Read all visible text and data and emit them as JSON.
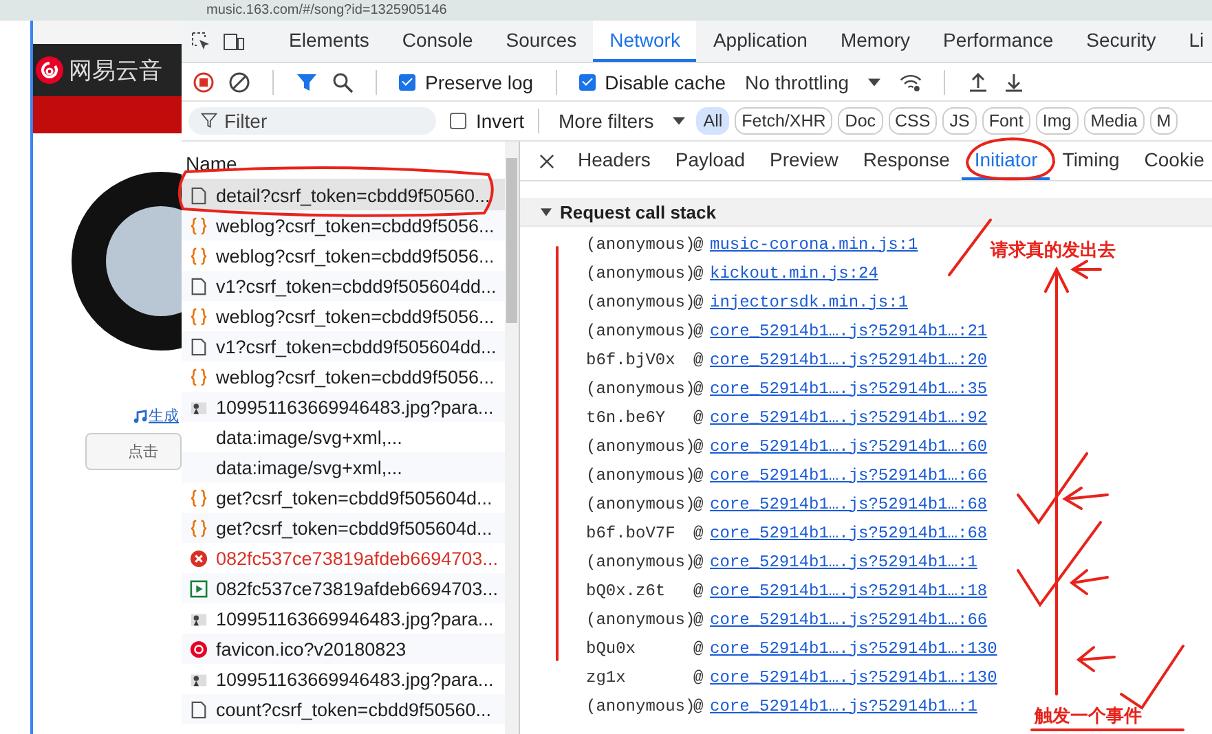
{
  "browser": {
    "address": "music.163.com/#/song?id=1325905146"
  },
  "page": {
    "logo": "网易云音",
    "link": "生成",
    "button": "点击"
  },
  "devtools": {
    "tabs": [
      {
        "label": "Elements",
        "selected": false
      },
      {
        "label": "Console",
        "selected": false
      },
      {
        "label": "Sources",
        "selected": false
      },
      {
        "label": "Network",
        "selected": true
      },
      {
        "label": "Application",
        "selected": false
      },
      {
        "label": "Memory",
        "selected": false
      },
      {
        "label": "Performance",
        "selected": false
      },
      {
        "label": "Security",
        "selected": false
      },
      {
        "label": "Li",
        "selected": false
      }
    ],
    "toolbar": {
      "preserve_log": {
        "label": "Preserve log",
        "checked": true
      },
      "disable_cache": {
        "label": "Disable cache",
        "checked": true
      },
      "throttling": "No throttling"
    },
    "filter": {
      "placeholder": "Filter",
      "invert": {
        "label": "Invert",
        "checked": false
      },
      "more_filters": "More filters",
      "types": [
        {
          "label": "All",
          "selected": true
        },
        {
          "label": "Fetch/XHR",
          "selected": false
        },
        {
          "label": "Doc",
          "selected": false
        },
        {
          "label": "CSS",
          "selected": false
        },
        {
          "label": "JS",
          "selected": false
        },
        {
          "label": "Font",
          "selected": false
        },
        {
          "label": "Img",
          "selected": false
        },
        {
          "label": "Media",
          "selected": false
        },
        {
          "label": "M",
          "selected": false
        }
      ]
    },
    "requests": {
      "column": "Name",
      "rows": [
        {
          "kind": "doc",
          "name": "detail?csrf_token=cbdd9f50560...",
          "selected": true
        },
        {
          "kind": "xhr",
          "name": "weblog?csrf_token=cbdd9f5056...",
          "selected": false
        },
        {
          "kind": "xhr",
          "name": "weblog?csrf_token=cbdd9f5056...",
          "selected": false
        },
        {
          "kind": "doc",
          "name": "v1?csrf_token=cbdd9f505604dd...",
          "selected": false
        },
        {
          "kind": "xhr",
          "name": "weblog?csrf_token=cbdd9f5056...",
          "selected": false
        },
        {
          "kind": "doc",
          "name": "v1?csrf_token=cbdd9f505604dd...",
          "selected": false
        },
        {
          "kind": "xhr",
          "name": "weblog?csrf_token=cbdd9f5056...",
          "selected": false
        },
        {
          "kind": "img",
          "name": "109951163669946483.jpg?para...",
          "selected": false
        },
        {
          "kind": "none",
          "name": "data:image/svg+xml,...",
          "selected": false
        },
        {
          "kind": "none",
          "name": "data:image/svg+xml,...",
          "selected": false
        },
        {
          "kind": "xhr",
          "name": "get?csrf_token=cbdd9f505604d...",
          "selected": false
        },
        {
          "kind": "xhr",
          "name": "get?csrf_token=cbdd9f505604d...",
          "selected": false
        },
        {
          "kind": "error",
          "name": "082fc537ce73819afdeb6694703...",
          "selected": false
        },
        {
          "kind": "media",
          "name": "082fc537ce73819afdeb6694703...",
          "selected": false
        },
        {
          "kind": "img",
          "name": "109951163669946483.jpg?para...",
          "selected": false
        },
        {
          "kind": "favicon",
          "name": "favicon.ico?v20180823",
          "selected": false
        },
        {
          "kind": "img",
          "name": "109951163669946483.jpg?para...",
          "selected": false
        },
        {
          "kind": "doc",
          "name": "count?csrf_token=cbdd9f50560...",
          "selected": false
        }
      ]
    },
    "detail": {
      "tabs": [
        {
          "label": "Headers",
          "selected": false
        },
        {
          "label": "Payload",
          "selected": false
        },
        {
          "label": "Preview",
          "selected": false
        },
        {
          "label": "Response",
          "selected": false
        },
        {
          "label": "Initiator",
          "selected": true
        },
        {
          "label": "Timing",
          "selected": false
        },
        {
          "label": "Cookie",
          "selected": false
        }
      ],
      "section": {
        "title": "Request call stack",
        "expanded": true
      },
      "frames": [
        {
          "function": "(anonymous)",
          "separator": "@",
          "location": "music-corona.min.js:1"
        },
        {
          "function": "(anonymous)",
          "separator": "@",
          "location": "kickout.min.js:24"
        },
        {
          "function": "(anonymous)",
          "separator": "@",
          "location": "injectorsdk.min.js:1"
        },
        {
          "function": "(anonymous)",
          "separator": "@",
          "location": "core_52914b1….js?52914b1…:21"
        },
        {
          "function": "b6f.bjV0x",
          "separator": "@",
          "location": "core_52914b1….js?52914b1…:20"
        },
        {
          "function": "(anonymous)",
          "separator": "@",
          "location": "core_52914b1….js?52914b1…:35"
        },
        {
          "function": "t6n.be6Y",
          "separator": "@",
          "location": "core_52914b1….js?52914b1…:92"
        },
        {
          "function": "(anonymous)",
          "separator": "@",
          "location": "core_52914b1….js?52914b1…:60"
        },
        {
          "function": "(anonymous)",
          "separator": "@",
          "location": "core_52914b1….js?52914b1…:66"
        },
        {
          "function": "(anonymous)",
          "separator": "@",
          "location": "core_52914b1….js?52914b1…:68"
        },
        {
          "function": "b6f.boV7F",
          "separator": "@",
          "location": "core_52914b1….js?52914b1…:68"
        },
        {
          "function": "(anonymous)",
          "separator": "@",
          "location": "core_52914b1….js?52914b1…:1"
        },
        {
          "function": "bQ0x.z6t",
          "separator": "@",
          "location": "core_52914b1….js?52914b1…:18"
        },
        {
          "function": "(anonymous)",
          "separator": "@",
          "location": "core_52914b1….js?52914b1…:66"
        },
        {
          "function": "bQu0x",
          "separator": "@",
          "location": "core_52914b1….js?52914b1…:130"
        },
        {
          "function": "zg1x",
          "separator": "@",
          "location": "core_52914b1….js?52914b1…:130"
        },
        {
          "function": "(anonymous)",
          "separator": "@",
          "location": "core_52914b1….js?52914b1…:1"
        }
      ]
    }
  },
  "annotations": [
    {
      "text": "请求真的发出去"
    },
    {
      "text": "触发一个事件"
    }
  ]
}
